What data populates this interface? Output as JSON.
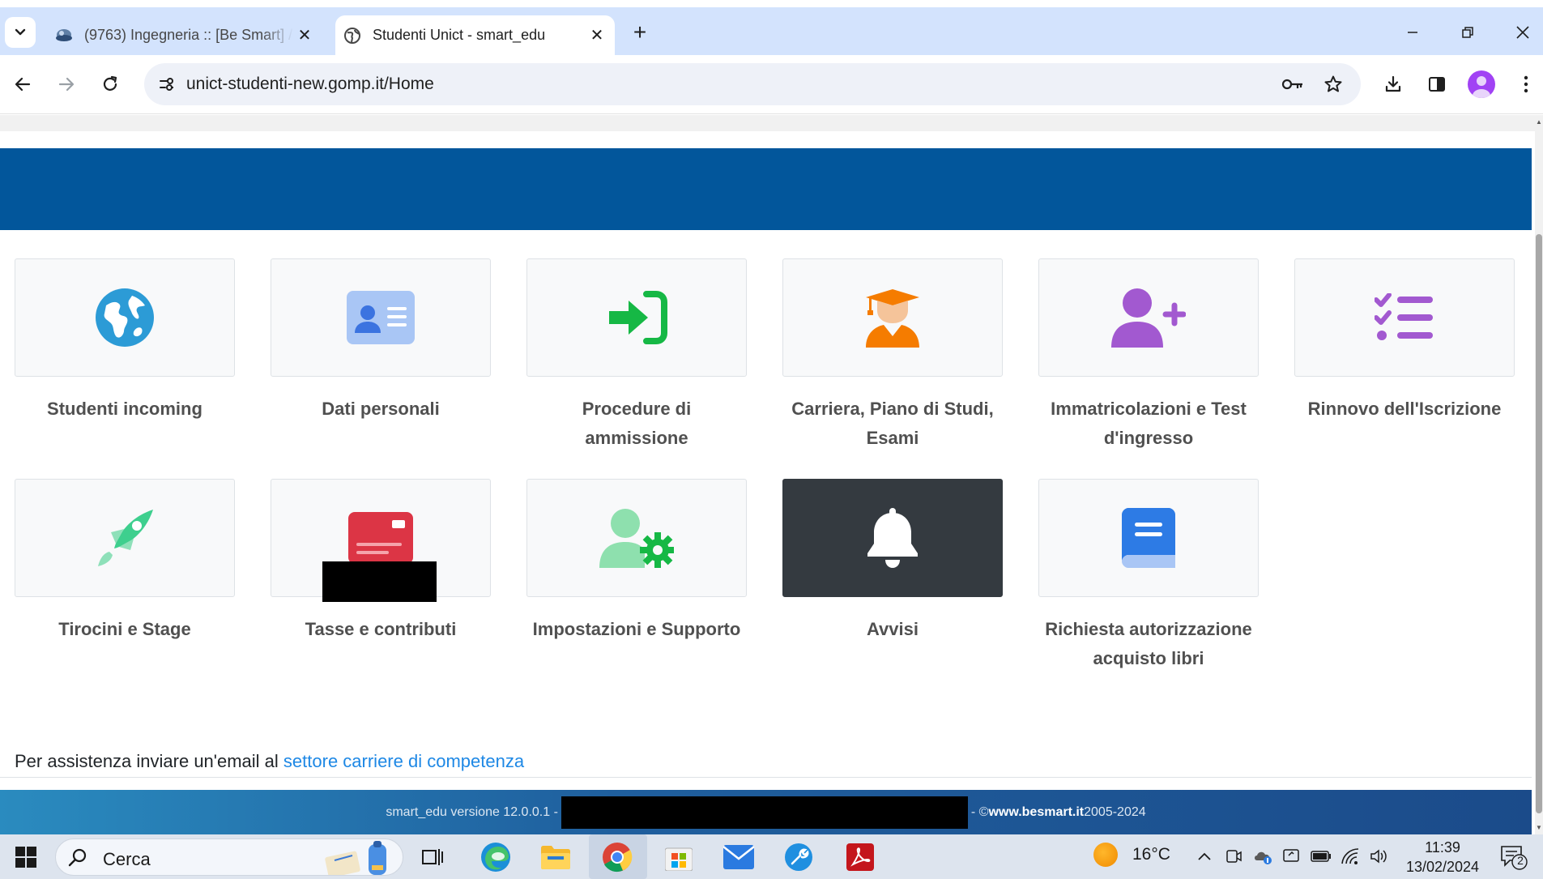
{
  "browser": {
    "tabs": [
      {
        "title": "(9763) Ingegneria :: [Be Smart] /",
        "active": false
      },
      {
        "title": "Studenti Unict - smart_edu",
        "active": true
      }
    ],
    "url": "unict-studenti-new.gomp.it/Home"
  },
  "tiles": [
    {
      "label": "Studenti incoming",
      "icon": "globe-icon",
      "color": "#2c9bd6"
    },
    {
      "label": "Dati personali",
      "icon": "id-card-icon",
      "color": "#4a86e8"
    },
    {
      "label": "Procedure di ammissione",
      "icon": "sign-in-icon",
      "color": "#16b845"
    },
    {
      "label": "Carriera, Piano di Studi, Esami",
      "icon": "graduate-icon",
      "color": "#f57c00"
    },
    {
      "label": "Immatricolazioni e Test d'ingresso",
      "icon": "user-plus-icon",
      "color": "#a259d0"
    },
    {
      "label": "Rinnovo dell'Iscrizione",
      "icon": "list-check-icon",
      "color": "#a259d0"
    },
    {
      "label": "Tirocini e Stage",
      "icon": "rocket-icon",
      "color": "#3ecf8e"
    },
    {
      "label": "Tasse e contributi",
      "icon": "credit-card-icon",
      "color": "#dc3545"
    },
    {
      "label": "Impostazioni e Supporto",
      "icon": "user-gear-icon",
      "color": "#16b845"
    },
    {
      "label": "Avvisi",
      "icon": "bell-icon",
      "color": "#ffffff"
    },
    {
      "label": "Richiesta autorizzazione acquisto libri",
      "icon": "book-icon",
      "color": "#2d7be5"
    }
  ],
  "assist": {
    "text": "Per assistenza inviare un'email al ",
    "link": "settore carriere di competenza"
  },
  "footer": {
    "version": "smart_edu versione 12.0.0.1 - ",
    "copyright_prefix": "- © ",
    "site": "www.besmart.it",
    "years": " 2005-2024"
  },
  "taskbar": {
    "search_placeholder": "Cerca",
    "temperature": "16°C",
    "time": "11:39",
    "date": "13/02/2024",
    "notification_count": "2"
  }
}
